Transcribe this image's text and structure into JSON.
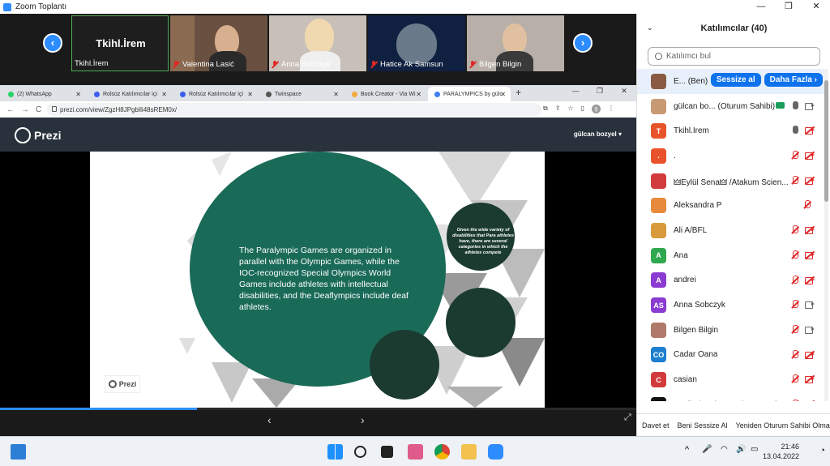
{
  "window": {
    "title": "Zoom Toplantı",
    "minimize": "—",
    "restore": "❐",
    "close": "✕"
  },
  "gallery": {
    "prev": "‹",
    "next": "›",
    "tiles": [
      {
        "name": "Tkihl.İrem",
        "center_label": "Tkihl.İrem"
      },
      {
        "name": "Valentina Lasić"
      },
      {
        "name": "Anna Sobczyk"
      },
      {
        "name": "Hatice Ak Samsun"
      },
      {
        "name": "Bilgen Bilgin"
      }
    ]
  },
  "browser": {
    "tabs": [
      {
        "label": "(2) WhatsApp",
        "color": "#25d366"
      },
      {
        "label": "Rolsüz Katılımcılar içi",
        "color": "#3b5ef0"
      },
      {
        "label": "Rolsüz Katılımcılar içi",
        "color": "#3b5ef0"
      },
      {
        "label": "Twinspace",
        "color": "#555555"
      },
      {
        "label": "Book Creator - Via Wi",
        "color": "#f2a93b"
      },
      {
        "label": "PARALYMPICS by gülc",
        "color": "#3f7ff0"
      }
    ],
    "new_tab": "+",
    "url": "prezi.com/view/ZgzH8JPgbIli48sREM0x/",
    "back": "←",
    "forward": "→",
    "reload": "C",
    "profile_initial": "g"
  },
  "prezi": {
    "logo": "Prezi",
    "user": "gülcan bozyel",
    "main_text": "The Paralympic Games are organized in parallel with the Olympic Games, while the IOC-recognized Special Olympics World Games include athletes with intellectual disabilities, and the Deaflympics include deaf athletes.",
    "small_text": "Given the wide variety of disabilities that Para athletes have, there are several categories in which the athletes compete",
    "slide_logo": "Prezi",
    "progress_fraction": 0.31,
    "prev": "‹",
    "next": "›",
    "fullscreen": "⤢"
  },
  "participants": {
    "title": "Katılımcılar (40)",
    "search_placeholder": "Katılımcı bul",
    "mute_button": "Sessize al",
    "more_button": "Daha Fazla ›",
    "list": [
      {
        "name": "E... (Ben)",
        "avatar": "",
        "color": "#8a5a44",
        "mic": "",
        "video": ""
      },
      {
        "name": "gülcan bo... (Oturum Sahibi)",
        "avatar": "",
        "color": "#c89a74",
        "mic": "on",
        "video": "on"
      },
      {
        "name": "Tkihl.İrem",
        "avatar": "T",
        "color": "#e8532b",
        "mic": "on",
        "video": "off"
      },
      {
        "name": ".",
        "avatar": ".",
        "color": "#e8532b",
        "mic": "off",
        "video": "off"
      },
      {
        "name": "🜲Eylül Sena🜲 /Atakum Scien...",
        "avatar": "",
        "color": "#d13b3b",
        "mic": "off",
        "video": "off"
      },
      {
        "name": "Aleksandra P",
        "avatar": "",
        "color": "#e88a3b",
        "mic": "off",
        "video": ""
      },
      {
        "name": "Ali A/BFL",
        "avatar": "",
        "color": "#d89a3b",
        "mic": "off",
        "video": "off"
      },
      {
        "name": "Ana",
        "avatar": "A",
        "color": "#2fa84f",
        "mic": "off",
        "video": "off"
      },
      {
        "name": "andrei",
        "avatar": "A",
        "color": "#8a3bd1",
        "mic": "off",
        "video": "off"
      },
      {
        "name": "Anna Sobczyk",
        "avatar": "AS",
        "color": "#8a3bd1",
        "mic": "off",
        "video": "on"
      },
      {
        "name": "Bilgen Bilgin",
        "avatar": "",
        "color": "#b07a6a",
        "mic": "off",
        "video": "on"
      },
      {
        "name": "Cadar Oana",
        "avatar": "CO",
        "color": "#1e7fd1",
        "mic": "off",
        "video": "off"
      },
      {
        "name": "casian",
        "avatar": "C",
        "color": "#d13b3b",
        "mic": "off",
        "video": "off"
      },
      {
        "name": "Ceylin / Atakum Science and Ar...",
        "avatar": "",
        "color": "#111111",
        "mic": "off",
        "video": "off"
      }
    ],
    "footer": [
      "Davet et",
      "Beni Sessize Al",
      "Yeniden Oturum Sahibi Olmay"
    ]
  },
  "taskbar": {
    "time": "21:46",
    "date": "13.04.2022",
    "tray_up": "^"
  }
}
